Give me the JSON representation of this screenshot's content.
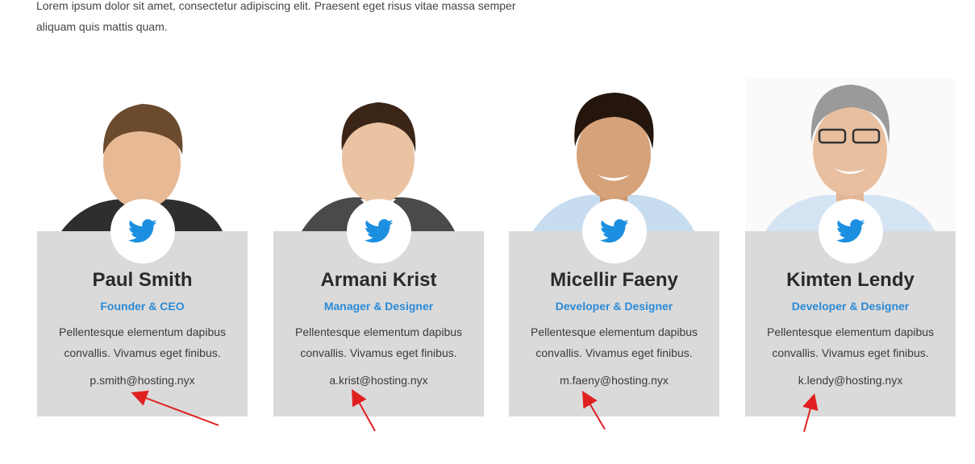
{
  "intro": {
    "text": "Lorem ipsum dolor sit amet, consectetur adipiscing elit. Praesent eget risus vitae massa semper aliquam quis mattis quam."
  },
  "team": [
    {
      "name": "Paul Smith",
      "role": "Founder & CEO",
      "description": "Pellentesque elementum dapibus convallis. Vivamus eget finibus.",
      "email": "p.smith@hosting.nyx",
      "social_icon": "twitter-icon"
    },
    {
      "name": "Armani Krist",
      "role": "Manager & Designer",
      "description": "Pellentesque elementum dapibus convallis. Vivamus eget finibus.",
      "email": "a.krist@hosting.nyx",
      "social_icon": "twitter-icon"
    },
    {
      "name": "Micellir Faeny",
      "role": "Developer & Designer",
      "description": "Pellentesque elementum dapibus convallis. Vivamus eget finibus.",
      "email": "m.faeny@hosting.nyx",
      "social_icon": "twitter-icon"
    },
    {
      "name": "Kimten Lendy",
      "role": "Developer & Designer",
      "description": "Pellentesque elementum dapibus convallis. Vivamus eget finibus.",
      "email": "k.lendy@hosting.nyx",
      "social_icon": "twitter-icon"
    }
  ],
  "colors": {
    "accent": "#2b8ad6",
    "card_bg": "#dadada",
    "name_text": "#2a2a2a",
    "body_text": "#3a3a3a",
    "annotation_arrow": "#e02020",
    "twitter_blue": "#1d8fe0"
  }
}
